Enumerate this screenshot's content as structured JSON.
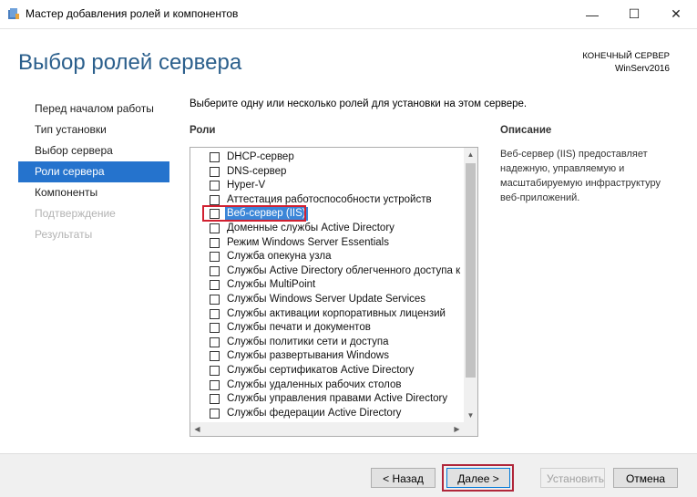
{
  "window": {
    "title": "Мастер добавления ролей и компонентов",
    "controls": {
      "minimize": "—",
      "maximize": "☐",
      "close": "✕"
    },
    "icon": "server-manager-icon"
  },
  "header": {
    "page_title": "Выбор ролей сервера",
    "destination_label": "КОНЕЧНЫЙ СЕРВЕР",
    "destination_server": "WinServ2016"
  },
  "nav": {
    "items": [
      {
        "label": "Перед началом работы",
        "state": "normal"
      },
      {
        "label": "Тип установки",
        "state": "normal"
      },
      {
        "label": "Выбор сервера",
        "state": "normal"
      },
      {
        "label": "Роли сервера",
        "state": "active"
      },
      {
        "label": "Компоненты",
        "state": "normal"
      },
      {
        "label": "Подтверждение",
        "state": "disabled"
      },
      {
        "label": "Результаты",
        "state": "disabled"
      }
    ]
  },
  "main": {
    "instruction": "Выберите одну или несколько ролей для установки на этом сервере.",
    "roles_heading": "Роли",
    "description_heading": "Описание",
    "description_text": "Веб-сервер (IIS) предоставляет надежную, управляемую и масштабируемую инфраструктуру веб-приложений.",
    "roles": [
      {
        "label": "DHCP-сервер",
        "checked": false,
        "selected": false
      },
      {
        "label": "DNS-сервер",
        "checked": false,
        "selected": false
      },
      {
        "label": "Hyper-V",
        "checked": false,
        "selected": false
      },
      {
        "label": "Аттестация работоспособности устройств",
        "checked": false,
        "selected": false
      },
      {
        "label": "Веб-сервер (IIS)",
        "checked": false,
        "selected": true
      },
      {
        "label": "Доменные службы Active Directory",
        "checked": false,
        "selected": false
      },
      {
        "label": "Режим Windows Server Essentials",
        "checked": false,
        "selected": false
      },
      {
        "label": "Служба опекуна узла",
        "checked": false,
        "selected": false
      },
      {
        "label": "Службы Active Directory облегченного доступа к",
        "checked": false,
        "selected": false
      },
      {
        "label": "Службы MultiPoint",
        "checked": false,
        "selected": false
      },
      {
        "label": "Службы Windows Server Update Services",
        "checked": false,
        "selected": false
      },
      {
        "label": "Службы активации корпоративных лицензий",
        "checked": false,
        "selected": false
      },
      {
        "label": "Службы печати и документов",
        "checked": false,
        "selected": false
      },
      {
        "label": "Службы политики сети и доступа",
        "checked": false,
        "selected": false
      },
      {
        "label": "Службы развертывания Windows",
        "checked": false,
        "selected": false
      },
      {
        "label": "Службы сертификатов Active Directory",
        "checked": false,
        "selected": false
      },
      {
        "label": "Службы удаленных рабочих столов",
        "checked": false,
        "selected": false
      },
      {
        "label": "Службы управления правами Active Directory",
        "checked": false,
        "selected": false
      },
      {
        "label": "Службы федерации Active Directory",
        "checked": false,
        "selected": false
      }
    ]
  },
  "footer": {
    "back_label": "< Назад",
    "next_label": "Далее >",
    "install_label": "Установить",
    "cancel_label": "Отмена"
  },
  "colors": {
    "accent": "#2573cd",
    "title": "#2b5f8c",
    "highlight_border": "#d12030"
  }
}
